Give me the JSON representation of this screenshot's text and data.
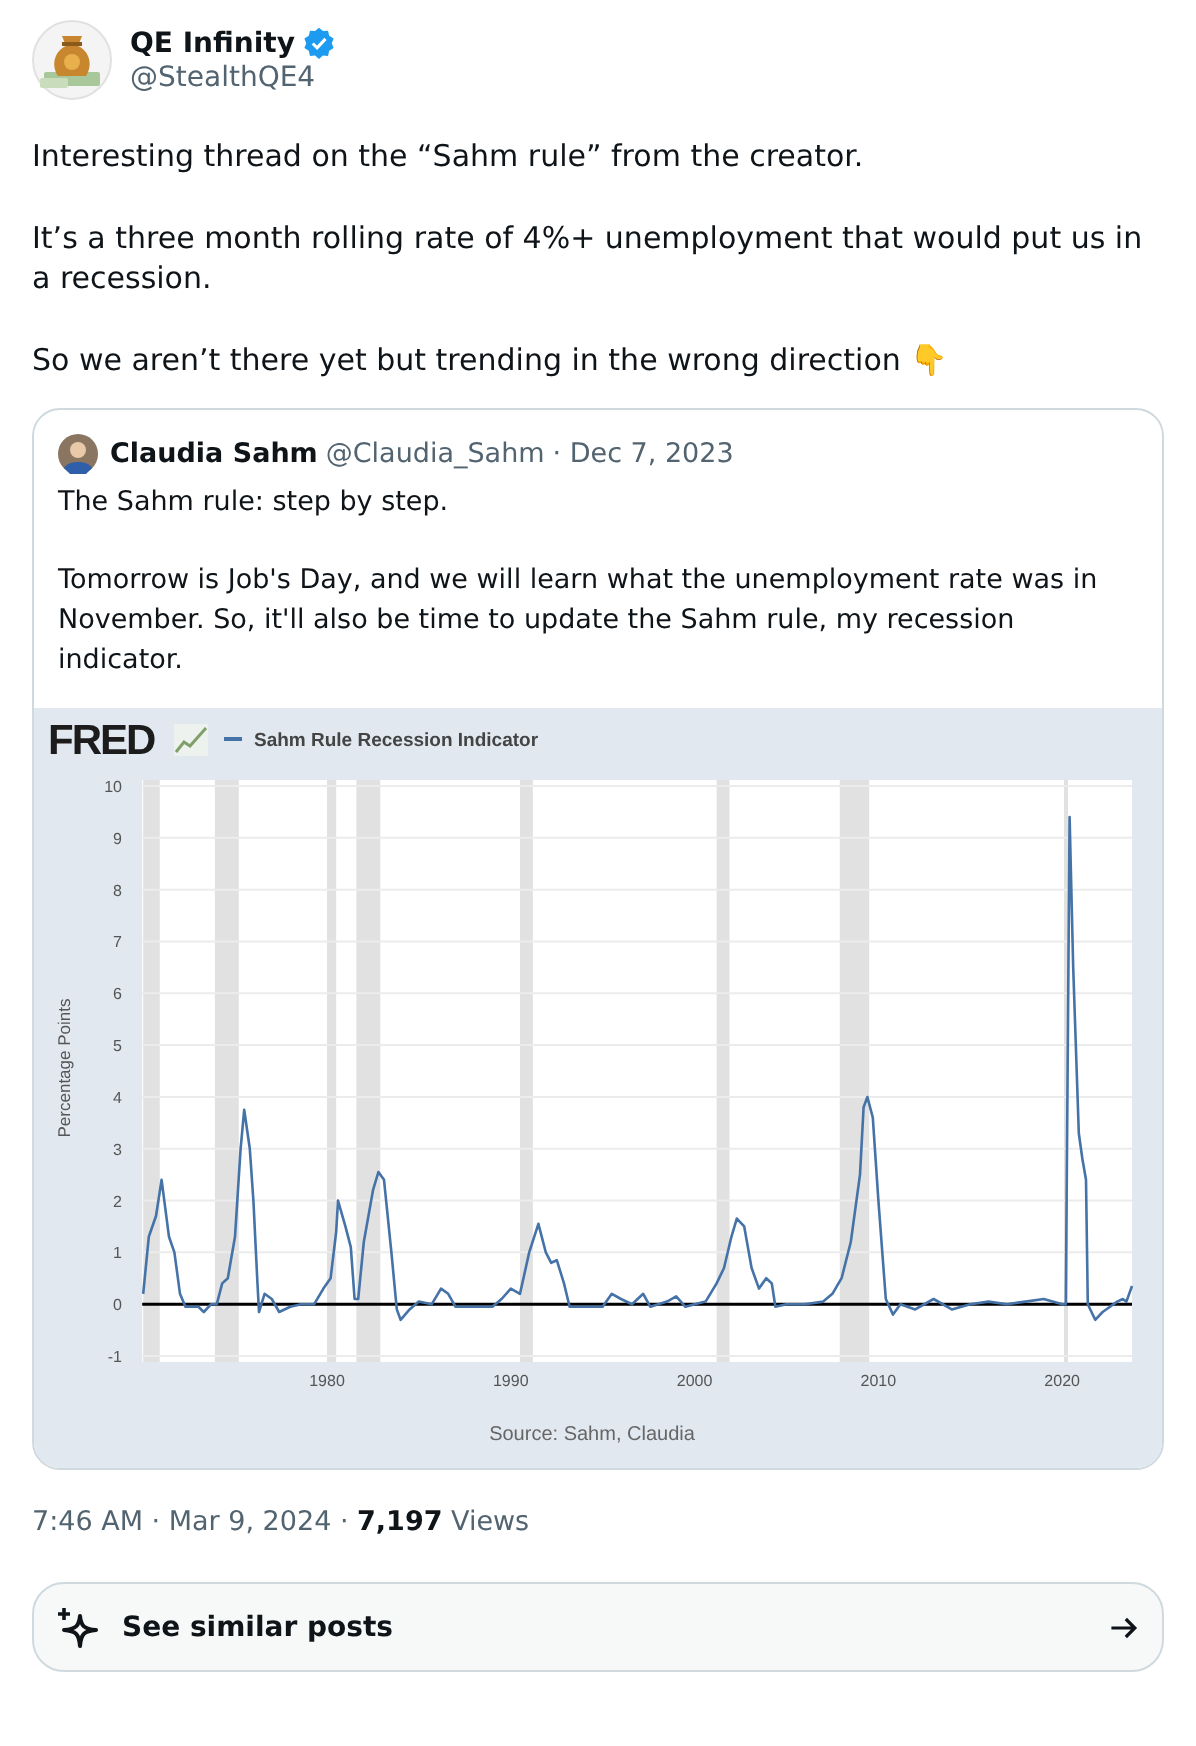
{
  "author": {
    "name": "QE Infinity",
    "verified": true,
    "handle": "@StealthQE4"
  },
  "text": [
    "Interesting thread on the “Sahm rule” from the creator.",
    "It’s a three month rolling rate of 4%+ unemployment that would put us in a recession.",
    "So we aren’t there yet but trending in the wrong direction 👇"
  ],
  "quote": {
    "name": "Claudia Sahm",
    "handle": "@Claudia_Sahm",
    "date": "· Dec 7, 2023",
    "text": [
      "The Sahm rule: step by step.",
      "Tomorrow is Job's Day, and we will learn what the unemployment rate was in November. So, it'll also be time to update the Sahm rule, my recession indicator."
    ],
    "image": {
      "logo": "FRED",
      "source": "Source: Sahm, Claudia",
      "chart_data": {
        "type": "line",
        "ylabel": "Percentage Points",
        "xlim": [
          1970,
          2023.8
        ],
        "ylim": [
          -1,
          10
        ],
        "xticks": [
          1980,
          1990,
          2000,
          2010,
          2020
        ],
        "yticks": [
          -1,
          0,
          1,
          2,
          3,
          4,
          5,
          6,
          7,
          8,
          9,
          10
        ],
        "grid": true,
        "bands": [
          {
            "axis": "x",
            "from": 1970,
            "to": 1970.9
          },
          {
            "axis": "x",
            "from": 1973.9,
            "to": 1975.2
          },
          {
            "axis": "x",
            "from": 1980,
            "to": 1980.5
          },
          {
            "axis": "x",
            "from": 1981.6,
            "to": 1982.9
          },
          {
            "axis": "x",
            "from": 1990.5,
            "to": 1991.2
          },
          {
            "axis": "x",
            "from": 2001.2,
            "to": 2001.9
          },
          {
            "axis": "x",
            "from": 2007.9,
            "to": 2009.5
          },
          {
            "axis": "x",
            "from": 2020.1,
            "to": 2020.3
          }
        ],
        "x": [
          1970.0,
          1970.3,
          1970.7,
          1971.0,
          1971.4,
          1971.7,
          1972.0,
          1972.3,
          1973.0,
          1973.3,
          1973.7,
          1974.0,
          1974.3,
          1974.6,
          1975.0,
          1975.3,
          1975.5,
          1975.8,
          1976.0,
          1976.2,
          1976.3,
          1976.6,
          1977.0,
          1977.4,
          1978.0,
          1978.6,
          1979.3,
          1979.8,
          1980.2,
          1980.5,
          1980.6,
          1981.0,
          1981.3,
          1981.5,
          1981.7,
          1982.0,
          1982.5,
          1982.8,
          1983.1,
          1983.5,
          1983.8,
          1984.0,
          1984.5,
          1985.0,
          1985.7,
          1986.2,
          1986.6,
          1987.0,
          1988.0,
          1989.0,
          1989.5,
          1990.0,
          1990.5,
          1991.0,
          1991.5,
          1991.9,
          1992.2,
          1992.5,
          1992.9,
          1993.2,
          1994.0,
          1995.0,
          1995.5,
          1996.0,
          1996.6,
          1997.2,
          1997.6,
          1998.5,
          1999.0,
          1999.5,
          2000.0,
          2000.6,
          2001.2,
          2001.6,
          2002.0,
          2002.3,
          2002.7,
          2003.1,
          2003.5,
          2003.9,
          2004.2,
          2004.4,
          2005.0,
          2006.0,
          2007.0,
          2007.5,
          2008.0,
          2008.5,
          2009.0,
          2009.2,
          2009.4,
          2009.7,
          2010.0,
          2010.4,
          2010.8,
          2011.2,
          2012.0,
          2013.0,
          2014.0,
          2015.0,
          2016.0,
          2017.0,
          2018.0,
          2019.0,
          2020.0,
          2020.2,
          2020.4,
          2020.6,
          2020.9,
          2021.1,
          2021.3,
          2021.4,
          2021.8,
          2022.2,
          2022.6,
          2023.0,
          2023.3,
          2023.5,
          2023.8
        ],
        "series": [
          {
            "name": "Sahm Rule Recession Indicator",
            "color": "#4572a7",
            "values": [
              0.2,
              1.3,
              1.7,
              2.4,
              1.3,
              1.0,
              0.2,
              -0.05,
              -0.05,
              -0.15,
              0,
              0,
              0.4,
              0.5,
              1.3,
              3.0,
              3.75,
              3.0,
              2.0,
              0.5,
              -0.15,
              0.2,
              0.1,
              -0.15,
              -0.05,
              0,
              0,
              0.3,
              0.5,
              1.4,
              2.0,
              1.5,
              1.1,
              0.1,
              0.1,
              1.2,
              2.2,
              2.55,
              2.4,
              1.0,
              -0.1,
              -0.3,
              -0.1,
              0.05,
              0,
              0.3,
              0.2,
              -0.05,
              -0.05,
              -0.05,
              0.1,
              0.3,
              0.2,
              1.0,
              1.55,
              1.0,
              0.8,
              0.85,
              0.4,
              -0.05,
              -0.05,
              -0.05,
              0.2,
              0.1,
              0,
              0.2,
              -0.05,
              0.05,
              0.15,
              -0.05,
              0,
              0.05,
              0.4,
              0.7,
              1.3,
              1.65,
              1.5,
              0.7,
              0.3,
              0.5,
              0.4,
              -0.05,
              0,
              0,
              0.05,
              0.2,
              0.5,
              1.2,
              2.5,
              3.8,
              4.0,
              3.6,
              2.0,
              0.1,
              -0.2,
              0,
              -0.1,
              0.1,
              -0.1,
              0,
              0.05,
              0,
              0.05,
              0.1,
              0,
              0,
              9.4,
              6.5,
              3.3,
              2.8,
              2.4,
              0,
              -0.3,
              -0.15,
              -0.05,
              0.05,
              0.1,
              0.05,
              0.35
            ]
          }
        ]
      }
    }
  },
  "meta": {
    "time": "7:46 AM · Mar 9, 2024 · ",
    "views_count": "7,197",
    "views_label": " Views"
  },
  "similar_button": {
    "label": "See similar posts"
  }
}
